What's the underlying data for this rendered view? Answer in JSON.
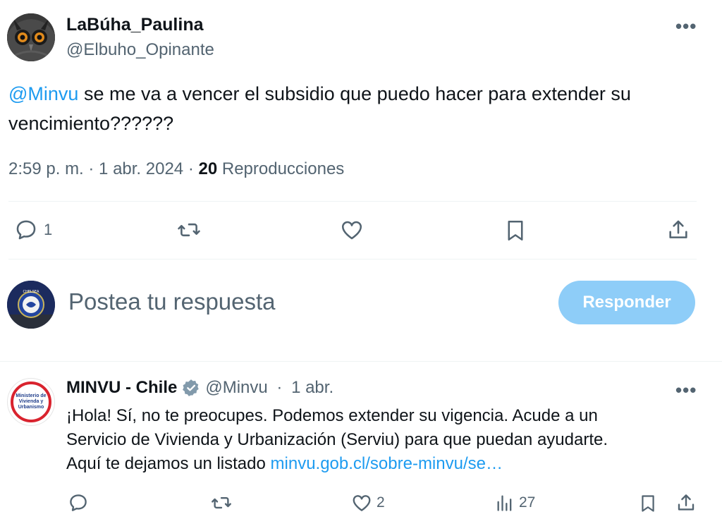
{
  "tweet": {
    "display_name": "LaBúha_Paulina",
    "handle": "@Elbuho_Opinante",
    "more_icon": "more-horizontal-icon",
    "text_mention": "@Minvu",
    "text_line1_rest": " se me va a vencer el subsidio que puedo hacer para extender su",
    "text_line2": "vencimiento??????",
    "time": "2:59 p. m. · 1 abr. 2024 · ",
    "views_count": "20",
    "views_label": " Reproducciones"
  },
  "actions": {
    "reply_icon": "comment-icon",
    "reply_count": "1",
    "retweet_icon": "retweet-icon",
    "like_icon": "heart-icon",
    "bookmark_icon": "bookmark-icon",
    "share_icon": "share-icon"
  },
  "composer": {
    "placeholder": "Postea tu respuesta",
    "button_label": "Responder",
    "avatar_alt": "Chelsea crest avatar"
  },
  "reply": {
    "display_name": "MINVU - Chile",
    "verified_icon": "verified-badge-icon",
    "handle": "@Minvu",
    "separator": " · ",
    "date": "1 abr.",
    "line1": "¡Hola! Sí, no te preocupes. Podemos extender su vigencia. Acude a un",
    "line2": "Servicio de Vivienda y Urbanización (Serviu) para que puedan ayudarte.",
    "line3_text": "Aquí te dejamos un listado ",
    "line3_link": "minvu.gob.cl/sobre-minvu/se…",
    "logo_text": "Ministerio de\nVivienda y\nUrbanismo",
    "like_count": "2",
    "views_count": "27"
  },
  "colors": {
    "accent": "#1d9bf0",
    "muted": "#536471",
    "button_disabled": "#8ecdf8"
  }
}
